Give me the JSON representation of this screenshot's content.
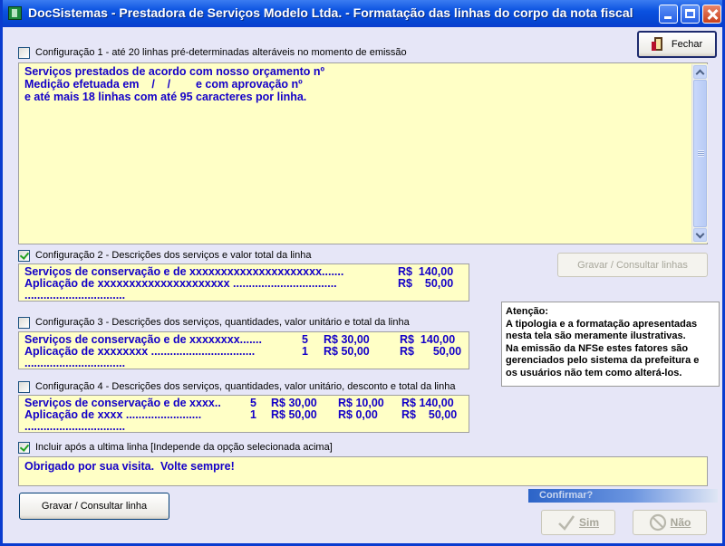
{
  "window": {
    "title": "DocSistemas - Prestadora de Serviços Modelo Ltda. - Formatação das linhas do corpo da nota fiscal"
  },
  "buttons": {
    "fechar": "Fechar",
    "gravar_consultar_linhas": "Gravar / Consultar linhas",
    "gravar_consultar_linha": "Gravar / Consultar linha",
    "sim": "Sim",
    "nao": "Não"
  },
  "config1": {
    "checked": false,
    "label": "Configuração 1 -  até 20 linhas pré-determinadas alteráveis no momento de emissão",
    "lines": [
      "Serviços prestados de acordo com nosso orçamento nº",
      "Medição efetuada em    /    /        e com aprovação nº",
      "e até mais 18 linhas com até 95 caracteres por linha."
    ]
  },
  "config2": {
    "checked": true,
    "label": "Configuração 2 -  Descrições dos serviços  e valor total da linha",
    "lines": [
      "Serviços de conservação e de xxxxxxxxxxxxxxxxxxxxx.......",
      "Aplicação de xxxxxxxxxxxxxxxxxxxxx .................................",
      "................................"
    ],
    "totals": [
      "R$  140,00",
      "R$    50,00"
    ]
  },
  "config3": {
    "checked": false,
    "label": "Configuração 3 -  Descrições dos serviços, quantidades, valor unitário e total da linha",
    "lines": [
      "Serviços de conservação e de xxxxxxxx.......",
      "Aplicação de xxxxxxxx .................................",
      "................................"
    ],
    "qty": [
      "5",
      "1"
    ],
    "unit": [
      "R$ 30,00",
      "R$ 50,00"
    ],
    "totals": [
      "R$  140,00",
      "R$      50,00"
    ]
  },
  "config4": {
    "checked": false,
    "label": "Configuração 4 -  Descrições dos serviços, quantidades, valor unitário, desconto e total da linha",
    "lines": [
      "Serviços de conservação e de xxxx..",
      "Aplicação de xxxx ........................",
      "................................"
    ],
    "qty": [
      "5",
      "1"
    ],
    "unit": [
      "R$ 30,00",
      "R$ 50,00"
    ],
    "discount": [
      "R$ 10,00",
      "R$ 0,00"
    ],
    "totals": [
      "R$ 140,00",
      "R$    50,00"
    ]
  },
  "include_last": {
    "checked": true,
    "label": "Incluir após a ultima linha [Independe da opção selecionada acima]",
    "text": "Obrigado por sua visita.  Volte sempre!"
  },
  "attention": {
    "heading": "Atenção:",
    "lines": [
      "A tipologia e a formatação apresentadas",
      "nesta tela são meramente ilustrativas.",
      "Na emissão da NFSe estes fatores são",
      "gerenciados pelo sistema da prefeitura e",
      "os usuários não tem como alterá-los."
    ]
  },
  "confirm": {
    "label": "Confirmar?"
  },
  "icons": {
    "app": "app-icon",
    "fechar": "door-exit-icon",
    "sim": "check-icon",
    "nao": "no-entry-icon"
  }
}
